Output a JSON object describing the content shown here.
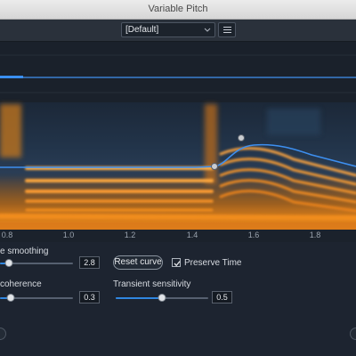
{
  "window": {
    "title": "Variable Pitch"
  },
  "preset": {
    "value": "[Default]",
    "dropdown_icon": "chevron-down-icon",
    "menu_icon": "hamburger-menu-icon"
  },
  "timeline": {
    "ticks": [
      "0.8",
      "1.0",
      "1.2",
      "1.4",
      "1.6",
      "1.8"
    ]
  },
  "controls": {
    "smoothing": {
      "label": "e smoothing",
      "value": "2.8",
      "level": 0.12
    },
    "reset_curve": "Reset curve",
    "preserve_time": {
      "label": "Preserve Time",
      "checked": true
    },
    "coherence": {
      "label": "coherence",
      "value": "0.3",
      "level": 0.15
    },
    "transient": {
      "label": "Transient sensitivity",
      "value": "0.5",
      "level": 0.5
    }
  },
  "colors": {
    "accent": "#2f86e0",
    "curve": "#3d8ff0",
    "spectrogram_hot": "#f08c1c"
  }
}
